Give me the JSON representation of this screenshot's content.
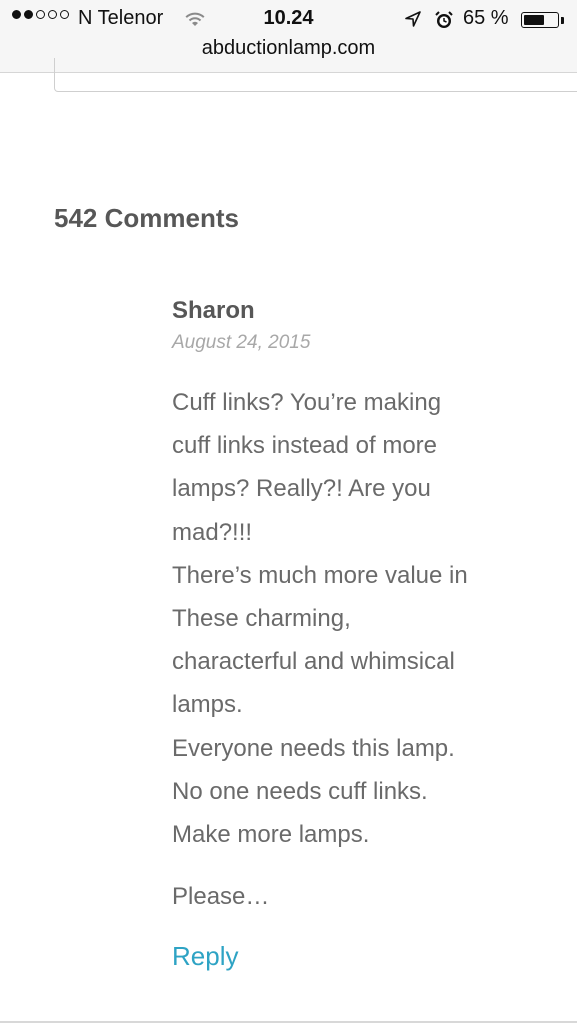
{
  "status_bar": {
    "carrier": "N Telenor",
    "time": "10.24",
    "battery_percent": "65 %",
    "battery_level": 0.65,
    "signal_bars_filled": 2,
    "signal_bars_total": 5,
    "icons": [
      "wifi-icon",
      "location-arrow-icon",
      "alarm-clock-icon",
      "battery-icon"
    ]
  },
  "address_bar": {
    "url": "abductionlamp.com"
  },
  "comments": {
    "title": "542 Comments",
    "items": [
      {
        "author": "Sharon",
        "date": "August 24, 2015",
        "paragraph_1": [
          "Cuff links? You’re making",
          "cuff links instead of more",
          "lamps? Really?! Are you",
          "mad?!!!",
          "There’s much more value in",
          "These charming,",
          "characterful and whimsical",
          "lamps.",
          "Everyone needs this lamp.",
          "No one needs cuff links.",
          "Make more lamps."
        ],
        "paragraph_2": [
          "Please…"
        ],
        "reply_label": "Reply"
      }
    ]
  },
  "colors": {
    "heading": "#575757",
    "body_text": "#6a6a6a",
    "date": "#a8a8a8",
    "link": "#2ea3c4"
  }
}
